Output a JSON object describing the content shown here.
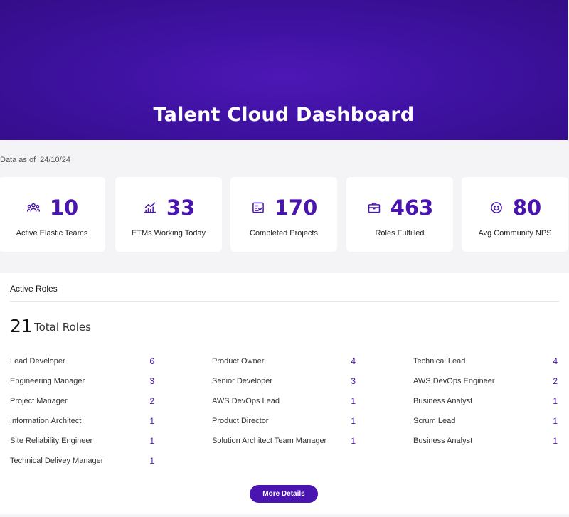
{
  "header": {
    "title": "Talent Cloud Dashboard"
  },
  "data_as_of": {
    "label": "Data as of",
    "date": "24/10/24"
  },
  "stats": [
    {
      "icon": "team-icon",
      "value": "10",
      "label": "Active Elastic Teams"
    },
    {
      "icon": "trend-chart-icon",
      "value": "33",
      "label": "ETMs Working Today"
    },
    {
      "icon": "checklist-icon",
      "value": "170",
      "label": "Completed Projects"
    },
    {
      "icon": "briefcase-icon",
      "value": "463",
      "label": "Roles Fulfilled"
    },
    {
      "icon": "smiley-icon",
      "value": "80",
      "label": "Avg Community NPS"
    }
  ],
  "accent_color": "#4a14b0",
  "roles": {
    "title": "Active Roles",
    "total_count": "21",
    "total_label": "Total Roles",
    "columns": [
      [
        {
          "name": "Lead Developer",
          "count": "6"
        },
        {
          "name": "Engineering Manager",
          "count": "3"
        },
        {
          "name": "Project Manager",
          "count": "2"
        },
        {
          "name": "Information Architect",
          "count": "1"
        },
        {
          "name": "Site Reliability Engineer",
          "count": "1"
        },
        {
          "name": "Technical Delivey Manager",
          "count": "1"
        }
      ],
      [
        {
          "name": "Product Owner",
          "count": "4"
        },
        {
          "name": "Senior Developer",
          "count": "3"
        },
        {
          "name": "AWS DevOps Lead",
          "count": "1"
        },
        {
          "name": "Product Director",
          "count": "1"
        },
        {
          "name": "Solution Architect Team Manager",
          "count": "1"
        }
      ],
      [
        {
          "name": "Technical Lead",
          "count": "4"
        },
        {
          "name": "AWS DevOps Engineer",
          "count": "2"
        },
        {
          "name": "Business Analyst",
          "count": "1"
        },
        {
          "name": "Scrum Lead",
          "count": "1"
        },
        {
          "name": "Business Analyst",
          "count": "1"
        }
      ]
    ],
    "more_button": "More Details"
  }
}
